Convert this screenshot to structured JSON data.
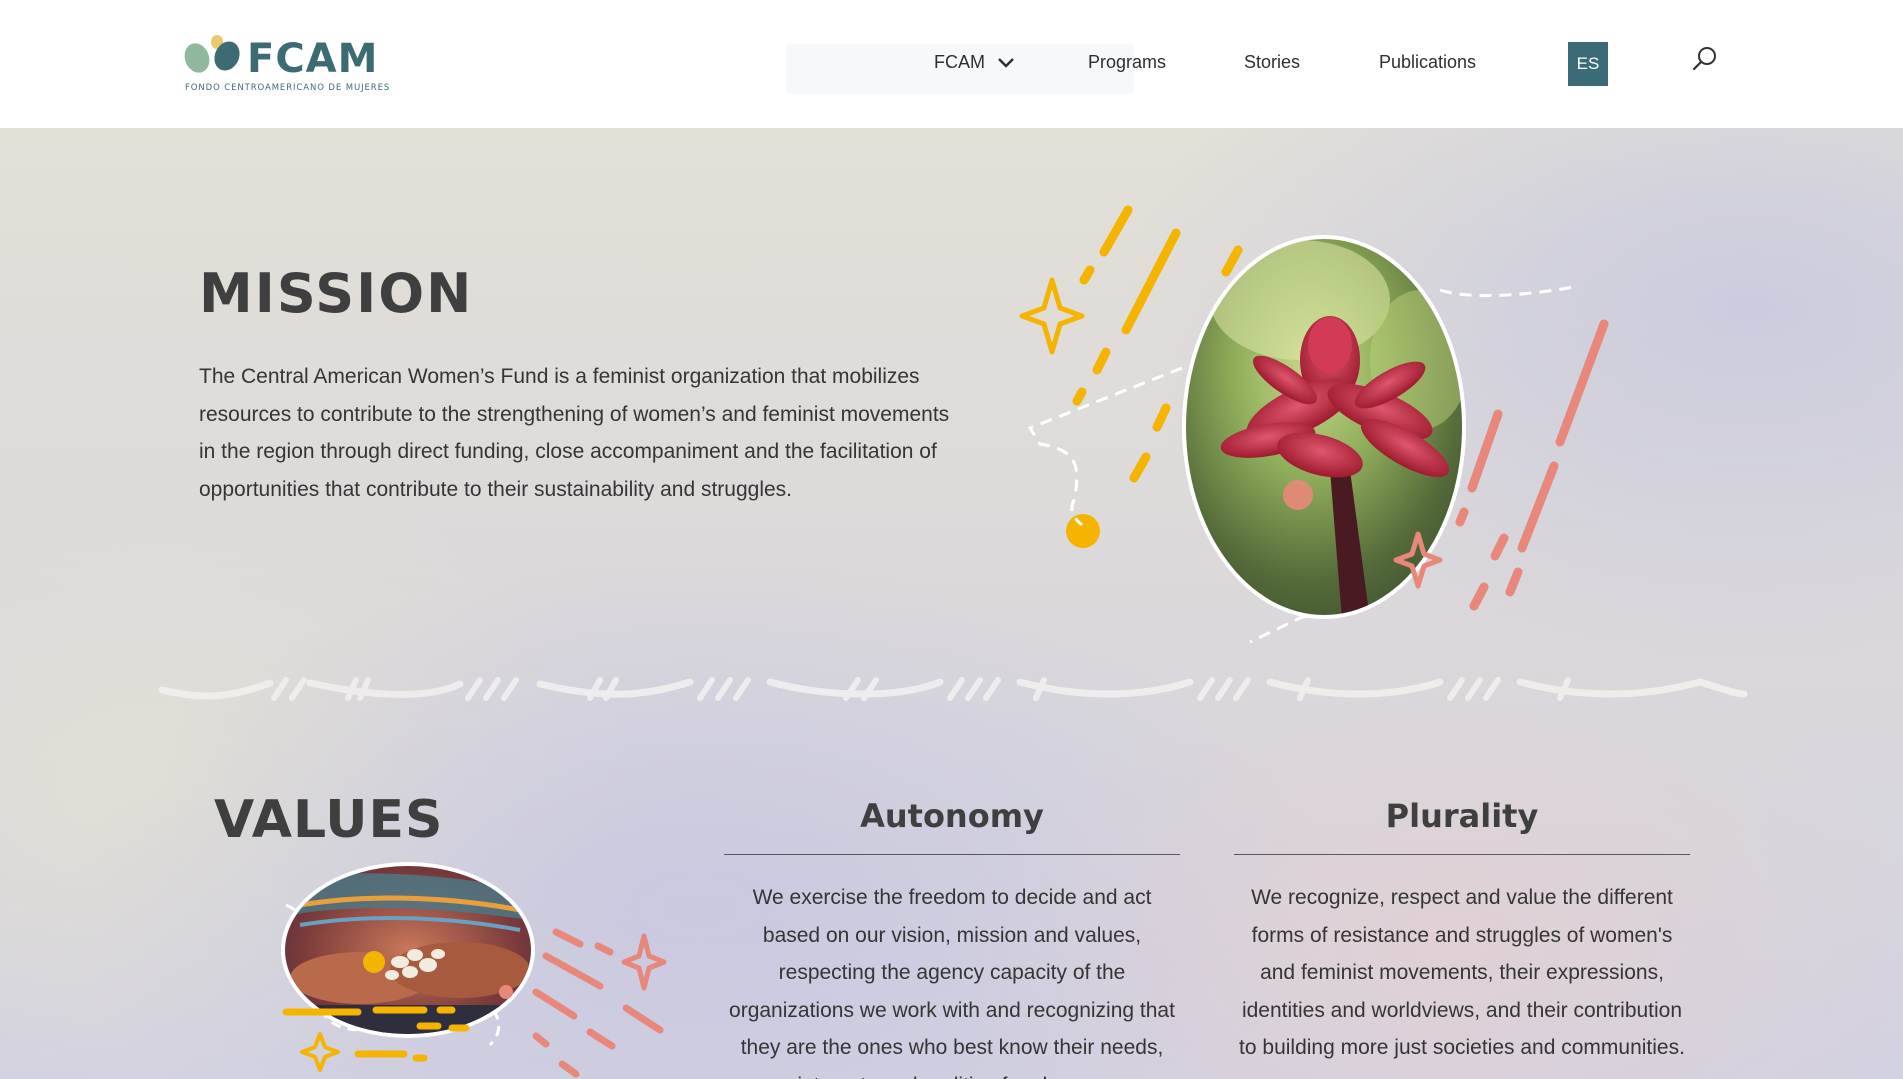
{
  "header": {
    "logo_word": "FCAM",
    "logo_subtitle": "FONDO CENTROAMERICANO DE MUJERES",
    "nav": [
      {
        "label": "FCAM"
      },
      {
        "label": "Programs"
      },
      {
        "label": "Stories"
      },
      {
        "label": "Publications"
      }
    ],
    "language_button": "ES",
    "icons": {
      "search": "search-icon",
      "dropdown": "chevron-down-icon"
    }
  },
  "mission": {
    "heading": "MISSION",
    "body": "The Central American Women’s Fund is a feminist organization that mobilizes resources to contribute to the strengthening of women’s and feminist movements in the region through direct funding, close accompaniment and the facilitation of opportunities that contribute to their sustainability and struggles."
  },
  "values": {
    "heading": "VALUES",
    "items": [
      {
        "title": "Autonomy",
        "text": "We exercise the freedom to decide and act based on our vision, mission and values, respecting the agency capacity of the organizations we work with and recognizing that they are the ones who best know their needs, interests and realities for change."
      },
      {
        "title": "Plurality",
        "text": "We recognize, respect and value the different forms of resistance and struggles of women's and feminist movements, their expressions, identities and worldviews, and their contribution to building more just societies and communities."
      }
    ]
  },
  "colors": {
    "brand_teal": "#3b6b76",
    "accent_yellow": "#f5b400",
    "accent_coral": "#e8887a",
    "text_dark": "#3f3f3f"
  }
}
